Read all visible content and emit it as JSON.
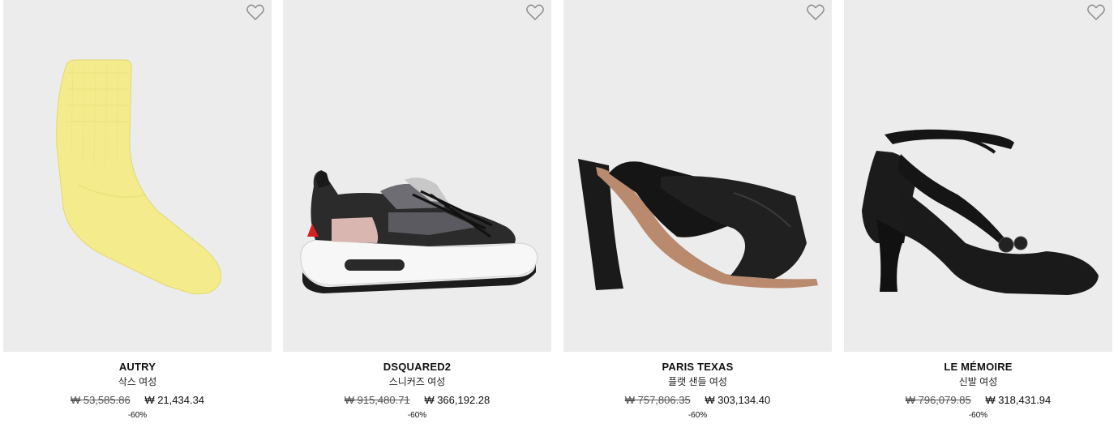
{
  "products": [
    {
      "brand": "AUTRY",
      "category": "삭스 여성",
      "old_price": "₩ 53,585.86",
      "new_price": "₩ 21,434.34",
      "discount": "-60%",
      "image_icon": "yellow-sock-image",
      "wishlist_icon": "heart-outline-icon"
    },
    {
      "brand": "DSQUARED2",
      "category": "스니커즈 여성",
      "old_price": "₩ 915,480.71",
      "new_price": "₩ 366,192.28",
      "discount": "-60%",
      "image_icon": "black-sneaker-image",
      "wishlist_icon": "heart-outline-icon"
    },
    {
      "brand": "PARIS TEXAS",
      "category": "플랫 샌들 여성",
      "old_price": "₩ 757,806.35",
      "new_price": "₩ 303,134.40",
      "discount": "-60%",
      "image_icon": "black-heeled-mule-image",
      "wishlist_icon": "heart-outline-icon"
    },
    {
      "brand": "LE MÉMOIRE",
      "category": "신발 여성",
      "old_price": "₩ 796,079.85",
      "new_price": "₩ 318,431.94",
      "discount": "-60%",
      "image_icon": "black-satin-pump-image",
      "wishlist_icon": "heart-outline-icon"
    }
  ],
  "colors": {
    "image_background": "#ececec",
    "text": "#1a1a1a",
    "strikethrough": "#555555"
  }
}
